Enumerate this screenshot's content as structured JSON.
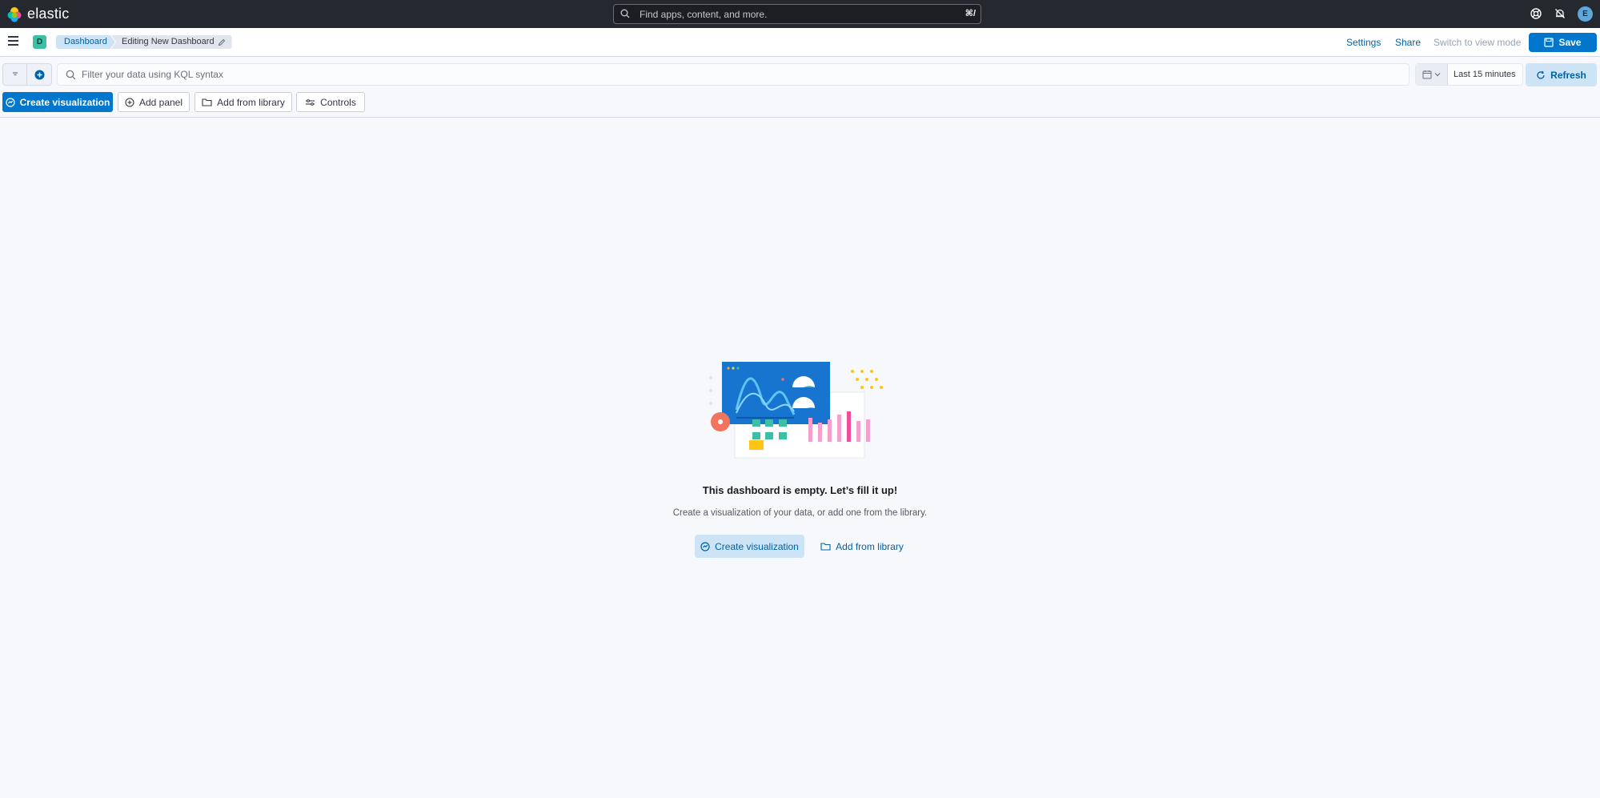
{
  "header": {
    "logo_text": "elastic",
    "search_placeholder": "Find apps, content, and more.",
    "search_shortcut": "⌘/",
    "user_initial": "E"
  },
  "subheader": {
    "space_initial": "D",
    "breadcrumbs": [
      "Dashboard",
      "Editing New Dashboard"
    ],
    "settings_label": "Settings",
    "share_label": "Share",
    "switch_view_label": "Switch to view mode",
    "save_label": "Save"
  },
  "querybar": {
    "kql_placeholder": "Filter your data using KQL syntax",
    "time_range": "Last 15 minutes",
    "refresh_label": "Refresh"
  },
  "toolbar": {
    "create_visualization": "Create visualization",
    "add_panel": "Add panel",
    "add_from_library": "Add from library",
    "controls": "Controls"
  },
  "empty_state": {
    "title": "This dashboard is empty. Let’s fill it up!",
    "body": "Create a visualization of your data, or add one from the library.",
    "create_visualization": "Create visualization",
    "add_from_library": "Add from library"
  },
  "colors": {
    "primary": "#0077cc",
    "header_bg": "#25282f",
    "page_bg": "#f7f8fc",
    "accent_teal": "#3dbfa5"
  }
}
